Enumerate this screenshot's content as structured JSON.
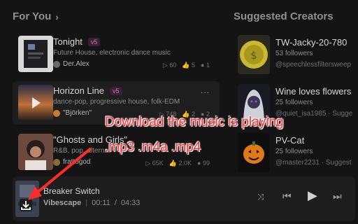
{
  "for_you": {
    "title": "For You",
    "chevron_icon": "chevron-right-icon"
  },
  "suggested": {
    "title": "Suggested Creators"
  },
  "songs": [
    {
      "title": "Tonight",
      "badge": "v5",
      "genre": "Future House, electronic dance music",
      "artist": "Der.Alex",
      "plays": "60",
      "likes": "5",
      "comments": "1"
    },
    {
      "title": "Horizon Line",
      "badge": "v5",
      "genre": "dance-pop, progressive house, folk-EDM",
      "artist": "\"Björken\"",
      "plays": "748",
      "likes": "2",
      "comments": "2",
      "more": "..."
    },
    {
      "title": "\"Ghosts and Girls\"",
      "badge": "",
      "genre": "R&B, pop, alternat",
      "artist": "frattogod",
      "plays": "65K",
      "likes": "2.0K",
      "comments": "99"
    }
  ],
  "creators": [
    {
      "name": "TW-Jacky-20-780",
      "followers": "53 followers",
      "handle": "@speechlessfiltersweep"
    },
    {
      "name": "Wine loves flowers",
      "followers": "25 followers",
      "handle": "@quiet_isa1985 · Sugge"
    },
    {
      "name": "PV-Cat",
      "followers": "25 followers",
      "handle": "@master2231 · Suggest"
    }
  ],
  "player": {
    "title": "Breaker Switch",
    "artist": "Vibescape",
    "current": "00:11",
    "sep": "/",
    "total": "04:33"
  },
  "annotation": {
    "line1": "Download the music is playing",
    "line2": ".mp3 .m4a .mp4",
    "color": "#ff2a2a"
  }
}
